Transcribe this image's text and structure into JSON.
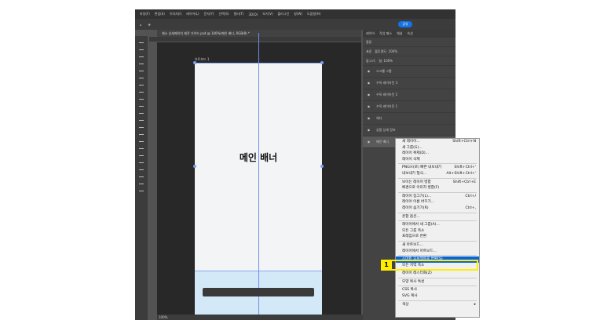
{
  "app": {
    "menus": [
      "파일(F)",
      "편집(E)",
      "이미지(I)",
      "레이어(L)",
      "문자(Y)",
      "선택(S)",
      "필터(T)",
      "3D(D)",
      "보기(V)",
      "플러그인",
      "창(W)",
      "도움말(H)"
    ],
    "share_label": "공유"
  },
  "document": {
    "tab_title": "제소 상세페이지 제작 가이드.psd @ 100%(메인 배너, RGB/8) *",
    "artboard_label": "아트보드 1",
    "banner_text": "메인 배너",
    "status": "100%"
  },
  "panel": {
    "tabs": [
      "레이어",
      "작업 패스",
      "채널",
      "속성"
    ],
    "filter": "종류",
    "blend": "표준",
    "opacity_label": "불투명도:",
    "opacity": "100%",
    "lock_label": "잠그기:",
    "fill_label": "칠:",
    "fill": "100%",
    "layers": [
      "스크롤 그룹",
      "수직 레이아웃 3",
      "수직 레이아웃 2",
      "수직 레이아웃 1",
      "헤더",
      "상품 상세 정보",
      "메인 배너"
    ]
  },
  "context_menu": {
    "items": [
      {
        "label": "새 레이어...",
        "shortcut": "Shift+Ctrl+N"
      },
      {
        "label": "새 그룹(G)...",
        "shortcut": ""
      },
      {
        "label": "레이어 복제(D)...",
        "shortcut": ""
      },
      {
        "label": "레이어 삭제",
        "shortcut": ""
      },
      {
        "sep": true
      },
      {
        "label": "PNG으(로) 빠른 내보내기",
        "shortcut": "Shift+Ctrl+'"
      },
      {
        "label": "내보내기 형식...",
        "shortcut": "Alt+Shift+Ctrl+'"
      },
      {
        "sep": true
      },
      {
        "label": "보이는 레이어 병합",
        "shortcut": "Shift+Ctrl+E"
      },
      {
        "label": "배경으로 이미지 병합(F)",
        "shortcut": ""
      },
      {
        "sep": true
      },
      {
        "label": "레이어 잠그기(L)...",
        "shortcut": "Ctrl+/"
      },
      {
        "label": "레이어 이름 바꾸기...",
        "shortcut": ""
      },
      {
        "label": "레이어 숨기기(R)",
        "shortcut": "Ctrl+,"
      },
      {
        "sep": true
      },
      {
        "label": "혼합 옵션...",
        "shortcut": ""
      },
      {
        "sep": true
      },
      {
        "label": "레이어에서 새 그룹(A)...",
        "shortcut": ""
      },
      {
        "label": "모든 그룹 축소",
        "shortcut": ""
      },
      {
        "label": "프레임으로 변환",
        "shortcut": ""
      },
      {
        "sep": true
      },
      {
        "label": "새 아트보드...",
        "shortcut": ""
      },
      {
        "label": "레이어에서 아트보드...",
        "shortcut": ""
      },
      {
        "sep": true
      },
      {
        "label": "스마트 오브젝트로 변환(S)",
        "shortcut": "",
        "highlight": true
      },
      {
        "label": "모든 지역 축소",
        "shortcut": ""
      },
      {
        "sep": true
      },
      {
        "label": "레이어 래스터화(Z)",
        "shortcut": ""
      },
      {
        "sep": true
      },
      {
        "label": "모양 복사 특성",
        "shortcut": ""
      },
      {
        "sep": true
      },
      {
        "label": "CSS 복사",
        "shortcut": ""
      },
      {
        "label": "SVG 복사",
        "shortcut": ""
      },
      {
        "sep": true
      },
      {
        "label": "색상",
        "shortcut": "▸"
      }
    ]
  },
  "annotation": {
    "step": "1",
    "color": "#ffee00"
  }
}
